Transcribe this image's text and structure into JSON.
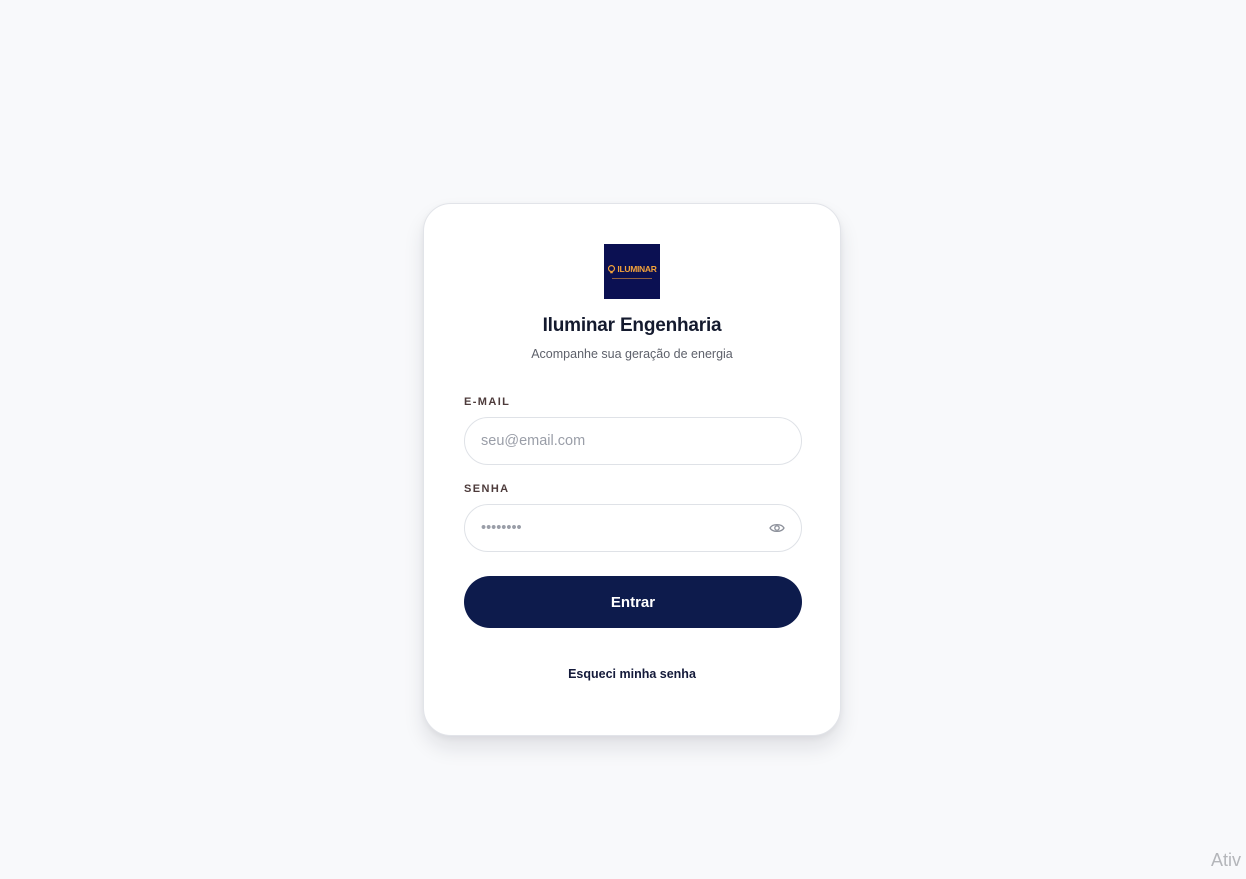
{
  "brand": {
    "logo_text": "ILUMINAR",
    "name": "Iluminar Engenharia",
    "tagline": "Acompanhe sua geração de energia",
    "logo_bg": "#0b1052",
    "logo_fg": "#f3a23a"
  },
  "form": {
    "email_label": "E-MAIL",
    "email_placeholder": "seu@email.com",
    "password_label": "SENHA",
    "password_placeholder": "••••••••",
    "password_toggle_icon": "eye-icon",
    "submit_label": "Entrar",
    "forgot_label": "Esqueci minha senha"
  },
  "colors": {
    "primary": "#0d1b4c",
    "background": "#f8f9fb",
    "label": "#4d3b3b"
  },
  "watermark": {
    "text": "Ativ"
  }
}
